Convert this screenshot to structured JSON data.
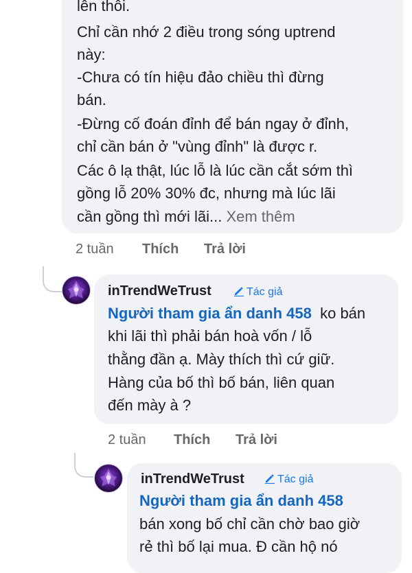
{
  "comment1": {
    "lines": [
      "lên thôi.",
      "Chỉ cần nhớ 2 điều trong sóng uptrend",
      "này:",
      "-Chưa có tín hiệu đảo chiều thì đừng",
      "bán.",
      "-Đừng cố đoán đỉnh để bán ngay ở đỉnh,",
      "chỉ cần bán ở \"vùng đỉnh\" là được r.",
      "Các ô lạ thật, lúc lỗ là lúc cần cắt sớm thì",
      "gồng lỗ 20% 30% đc, nhưng mà lúc lãi",
      "cần gồng thì mới lãi..."
    ],
    "see_more": "Xem thêm",
    "time": "2 tuần",
    "like": "Thích",
    "reply": "Trả lời"
  },
  "comment2": {
    "author": "inTrendWeTrust",
    "author_badge": "Tác giả",
    "mention": "Người tham gia ẩn danh 458",
    "first_line_rest": "ko bán",
    "lines": [
      "khi lãi thì phải bán hoà vốn / lỗ",
      "thằng đần ạ. Mày thích thì cứ giữ.",
      "Hàng của bố thì bố bán, liên quan",
      "đến mày à ?"
    ],
    "time": "2 tuần",
    "like": "Thích",
    "reply": "Trả lời"
  },
  "comment3": {
    "author": "inTrendWeTrust",
    "author_badge": "Tác giả",
    "mention": "Người tham gia ẩn danh 458",
    "lines": [
      "bán xong bố chỉ cần chờ bao giờ",
      "rẻ thì bố lại mua. Đ cần hộ nó"
    ]
  },
  "colors": {
    "bubble": "#f0f2f5",
    "mention": "#1566c0",
    "badge": "#1877f2",
    "meta": "#65676b"
  }
}
